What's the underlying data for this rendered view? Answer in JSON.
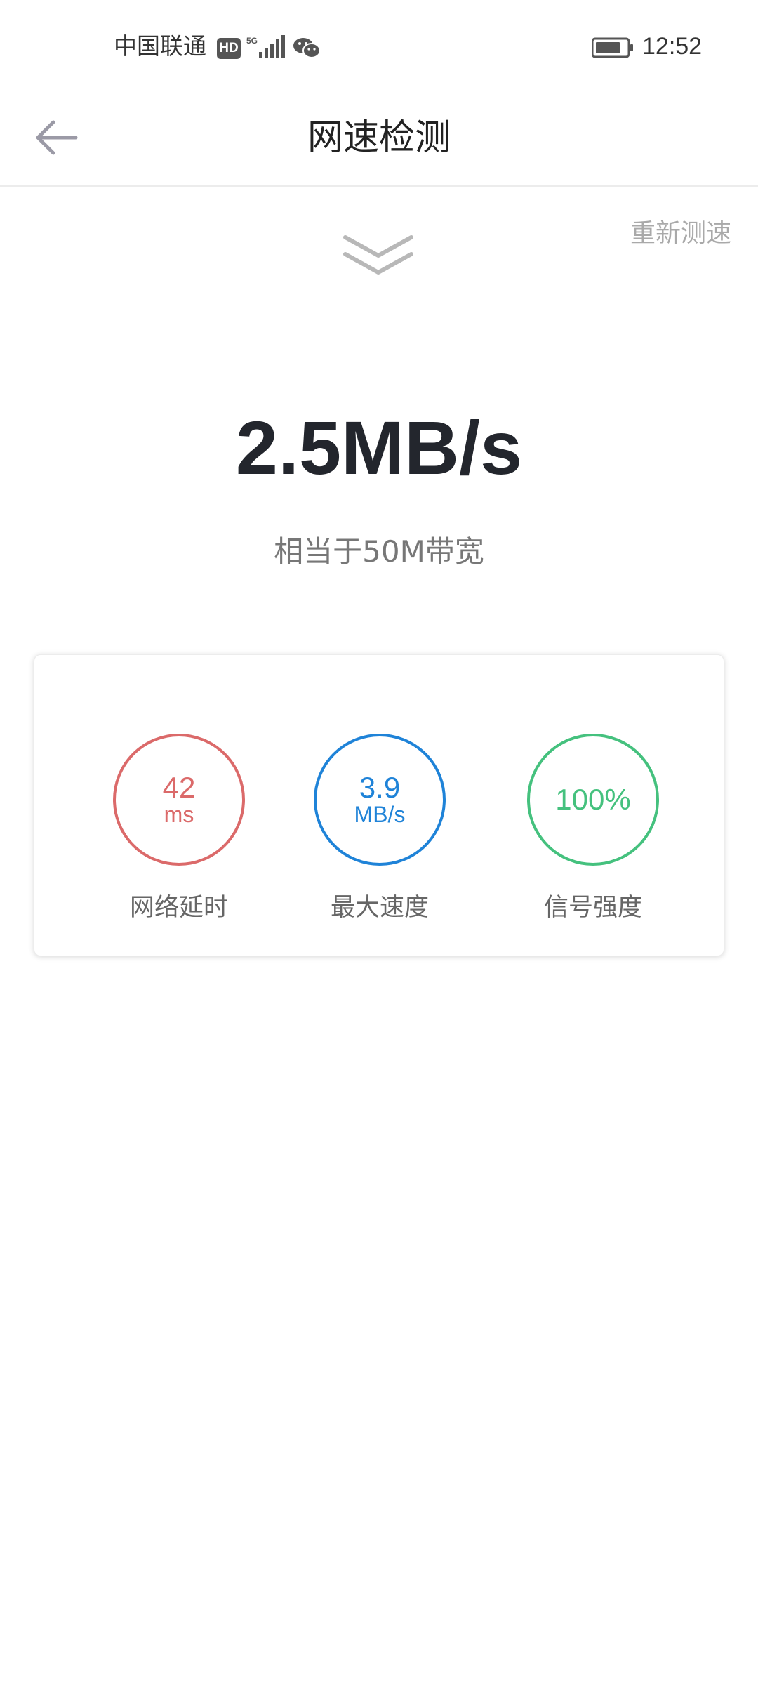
{
  "status_bar": {
    "carrier": "中国联通",
    "hd_badge": "HD",
    "network": "5G",
    "time": "12:52",
    "icons": [
      "hd-icon",
      "signal-icon",
      "wechat-icon",
      "battery-icon"
    ]
  },
  "nav": {
    "title": "网速检测",
    "back_icon": "arrow-left-icon"
  },
  "retest_label": "重新测速",
  "speed": {
    "value": "2.5MB/s",
    "bandwidth": "相当于50M带宽"
  },
  "stats": [
    {
      "value": "42",
      "unit": "ms",
      "label": "网络延时",
      "color": "#db6a6a"
    },
    {
      "value": "3.9",
      "unit": "MB/s",
      "label": "最大速度",
      "color": "#1f83d8"
    },
    {
      "value": "100%",
      "unit": "",
      "label": "信号强度",
      "color": "#45c17e"
    }
  ],
  "colors": {
    "accent_red": "#db6a6a",
    "accent_blue": "#1f83d8",
    "accent_green": "#45c17e",
    "muted": "#a9a9a9"
  }
}
